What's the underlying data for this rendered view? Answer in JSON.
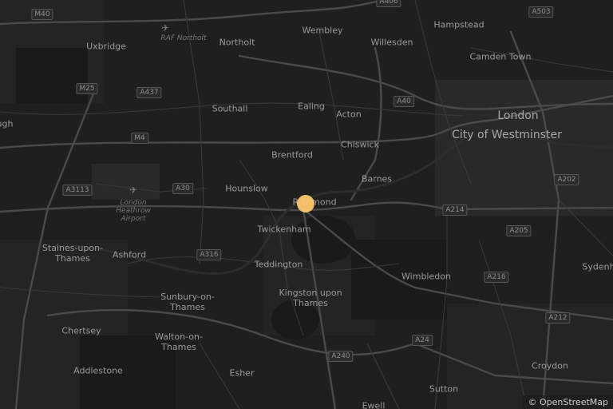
{
  "places": [
    {
      "name": "Wembley",
      "style": ""
    },
    {
      "name": "Willesden",
      "style": ""
    },
    {
      "name": "Hampstead",
      "style": ""
    },
    {
      "name": "Camden Town",
      "style": ""
    },
    {
      "name": "Uxbridge",
      "style": ""
    },
    {
      "name": "Northolt",
      "style": ""
    },
    {
      "name": "RAF Northolt",
      "style": "faint"
    },
    {
      "name": "Southall",
      "style": ""
    },
    {
      "name": "Ealing",
      "style": ""
    },
    {
      "name": "Acton",
      "style": ""
    },
    {
      "name": "London",
      "style": "big"
    },
    {
      "name": "City of Westminster",
      "style": "big"
    },
    {
      "name": "Chiswick",
      "style": ""
    },
    {
      "name": "Brentford",
      "style": ""
    },
    {
      "name": "Hounslow",
      "style": ""
    },
    {
      "name": "Barnes",
      "style": ""
    },
    {
      "name": "Richmond",
      "style": ""
    },
    {
      "name": "London Heathrow Airport",
      "style": "faint"
    },
    {
      "name": "Twickenham",
      "style": ""
    },
    {
      "name": "Staines-upon-Thames",
      "style": ""
    },
    {
      "name": "Ashford",
      "style": ""
    },
    {
      "name": "Teddington",
      "style": ""
    },
    {
      "name": "Wimbledon",
      "style": ""
    },
    {
      "name": "Sunbury-on-Thames",
      "style": ""
    },
    {
      "name": "Kingston upon Thames",
      "style": ""
    },
    {
      "name": "Chertsey",
      "style": ""
    },
    {
      "name": "Walton-on-Thames",
      "style": ""
    },
    {
      "name": "Addlestone",
      "style": ""
    },
    {
      "name": "Esher",
      "style": ""
    },
    {
      "name": "Sutton",
      "style": ""
    },
    {
      "name": "Croydon",
      "style": ""
    },
    {
      "name": "Sydenh",
      "style": ""
    },
    {
      "name": "Ewell",
      "style": ""
    },
    {
      "name": "ugh",
      "style": ""
    }
  ],
  "roads": [
    "M40",
    "A406",
    "A503",
    "M25",
    "A437",
    "A40",
    "M4",
    "A3113",
    "A30",
    "A316",
    "A214",
    "A202",
    "A205",
    "A216",
    "A212",
    "A24",
    "A240"
  ],
  "marker": {
    "color": "#ffc66e",
    "label": "Richmond"
  },
  "attribution": "© OpenStreetMap"
}
